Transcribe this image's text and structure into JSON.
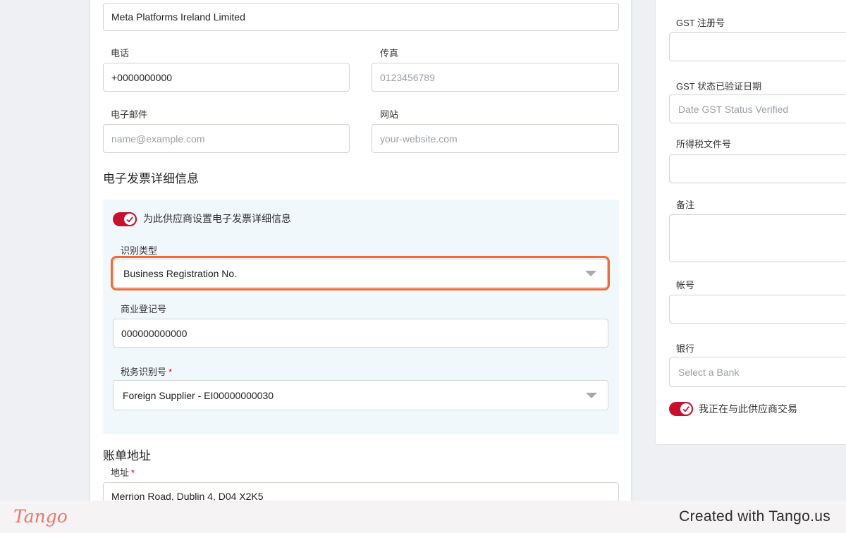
{
  "left_form": {
    "company_name_value": "Meta Platforms Ireland Limited",
    "phone": {
      "label": "电话",
      "value": "+0000000000"
    },
    "fax": {
      "label": "传真",
      "placeholder": "0123456789"
    },
    "email": {
      "label": "电子邮件",
      "placeholder": "name@example.com"
    },
    "website": {
      "label": "网站",
      "placeholder": "your-website.com"
    },
    "einvoice": {
      "section_title": "电子发票详细信息",
      "toggle_label": "为此供应商设置电子发票详细信息",
      "toggle_on": true,
      "id_type": {
        "label": "识别类型",
        "value": "Business Registration No."
      },
      "brn": {
        "label": "商业登记号",
        "value": "000000000000"
      },
      "tin": {
        "label": "税务识别号",
        "required_mark": "*",
        "value": "Foreign Supplier - EI00000000030"
      }
    },
    "billing": {
      "section_title": "账单地址",
      "address": {
        "label": "地址",
        "required_mark": "*",
        "value": "Merrion Road, Dublin 4, D04 X2K5"
      }
    }
  },
  "right_form": {
    "gst_reg": {
      "label": "GST 注册号",
      "value": ""
    },
    "gst_date": {
      "label": "GST 状态已验证日期",
      "placeholder": "Date GST Status Verified"
    },
    "income_tax": {
      "label": "所得税文件号",
      "value": ""
    },
    "remarks": {
      "label": "备注",
      "value": ""
    },
    "account_no": {
      "label": "帐号",
      "value": ""
    },
    "bank": {
      "label": "银行",
      "placeholder": "Select a Bank"
    },
    "trading_toggle": {
      "label": "我正在与此供应商交易",
      "on": true
    }
  },
  "colors": {
    "accent": "#c8102e",
    "highlight": "#f26a35",
    "panel_bg": "#f1f8fc"
  },
  "footer": {
    "logo_text": "Tango",
    "created_text": "Created with Tango.us"
  }
}
